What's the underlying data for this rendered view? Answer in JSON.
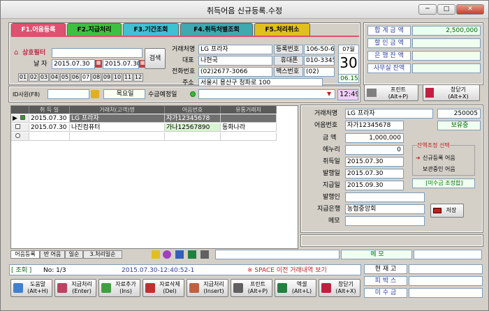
{
  "window": {
    "title": "취득어음 신규등록.수정",
    "min": "─",
    "max": "□",
    "close": "✕"
  },
  "tabs": [
    {
      "label": "F1.어음등록",
      "bg": "#e05070",
      "fg": "#ffffff"
    },
    {
      "label": "F2.지급처리",
      "bg": "#40c040",
      "fg": "#000000"
    },
    {
      "label": "F3.기간조회",
      "bg": "#40c0d0",
      "fg": "#000000"
    },
    {
      "label": "F4.취득처별조회",
      "bg": "#40a8b0",
      "fg": "#000000"
    },
    {
      "label": "F5.처리취소",
      "bg": "#e0c020",
      "fg": "#000000"
    }
  ],
  "filter": {
    "label": "상호필터",
    "date_label": "날 자",
    "date_from": "2015.07.30",
    "date_to": "2015.07.30",
    "search_btn": "검색",
    "months": [
      "01",
      "02",
      "03",
      "04",
      "05",
      "06",
      "07",
      "08",
      "09",
      "10",
      "11",
      "12"
    ]
  },
  "partner": {
    "name_label": "거래처명",
    "name": "LG 프라자",
    "rep_label": "대표",
    "rep": "나현국",
    "phone_label": "전화번호",
    "phone": "(02)2677-3066",
    "addr_label": "주소",
    "addr": "서울시 용산구 청파로 100",
    "reg_label": "등록번호",
    "reg": "106-50-633",
    "mobile_label": "휴대폰",
    "mobile": "010-3345-7",
    "fax_label": "팩스번호",
    "fax": "(02)"
  },
  "calendar": {
    "month": "07월",
    "day": "30",
    "date": "06.15"
  },
  "summary": [
    {
      "label": "합 계 금 액",
      "value": "2,500,000"
    },
    {
      "label": "할 인 금 액",
      "value": ""
    },
    {
      "label": "은 행 잔 액",
      "value": ""
    },
    {
      "label": "사무실 잔액",
      "value": ""
    }
  ],
  "toolbar2": {
    "staff": "ID사원(F8)",
    "weekday": "목요일",
    "due_label": "수금예정일",
    "time": "12:49",
    "print": "프린트",
    "print_key": "(Alt+P)",
    "close": "창닫기",
    "close_key": "(Alt+X)"
  },
  "grid": {
    "headers": [
      "취 득 일",
      "거래처(고객)명",
      "어음번호",
      "유통거래처"
    ],
    "rows": [
      [
        "2015.07.30",
        "LG 프라자",
        "자가12345678",
        ""
      ],
      [
        "2015.07.30",
        "나진컴퓨터",
        "가나12567890",
        "동화나라"
      ]
    ]
  },
  "detail": {
    "name_label": "거래처명",
    "name": "LG 프라자",
    "code": "250005",
    "no_label": "어음번호",
    "no": "자가12345678",
    "status": "보유중",
    "amount_label": "금  액",
    "amount": "1,000,000",
    "discount_label": "에누리",
    "discount": "0",
    "acq_label": "취득일",
    "acq": "2015.07.30",
    "issue_label": "발행일",
    "issue": "2015.07.30",
    "pay_label": "지급일",
    "pay": "2015.09.30",
    "issuer_label": "발행인",
    "issuer": "",
    "bank_label": "지급은행",
    "bank": "농협중앙회",
    "memo_label": "메모",
    "memo": "",
    "save": "저장"
  },
  "balance": {
    "title": "잔액조정 선택",
    "opt1": "신규등록 어음",
    "opt2": "보관중인 어음",
    "unpaid": "[미수금 조정합]"
  },
  "bottom_tabs": [
    "어음등록",
    "반 어음",
    "일순",
    "3.처리일순"
  ],
  "memo_label": "메  모",
  "status": {
    "query": "[ 조회 ]",
    "count": "No: 1/3",
    "timestamp": "2015.07.30-12:40:52-1",
    "hint": "※ SPACE 이전 거래내역 보기"
  },
  "right_info": [
    "현 재 고",
    "피 박 스",
    "미 수 금"
  ],
  "buttons": [
    {
      "label": "도움말",
      "key": "(Alt+H)",
      "color": "#4080d0"
    },
    {
      "label": "지급처리",
      "key": "(Enter)",
      "color": "#c04060"
    },
    {
      "label": "자료추가",
      "key": "(Ins)",
      "color": "#40a040"
    },
    {
      "label": "자료삭제",
      "key": "(Del)",
      "color": "#c03030"
    },
    {
      "label": "지급처리",
      "key": "(Insert)",
      "color": "#c06040"
    },
    {
      "label": "프린트",
      "key": "(Alt+P)",
      "color": "#606060"
    },
    {
      "label": "엑셀",
      "key": "(Alt+L)",
      "color": "#208040"
    },
    {
      "label": "창닫기",
      "key": "(Alt+X)",
      "color": "#c02040"
    }
  ]
}
